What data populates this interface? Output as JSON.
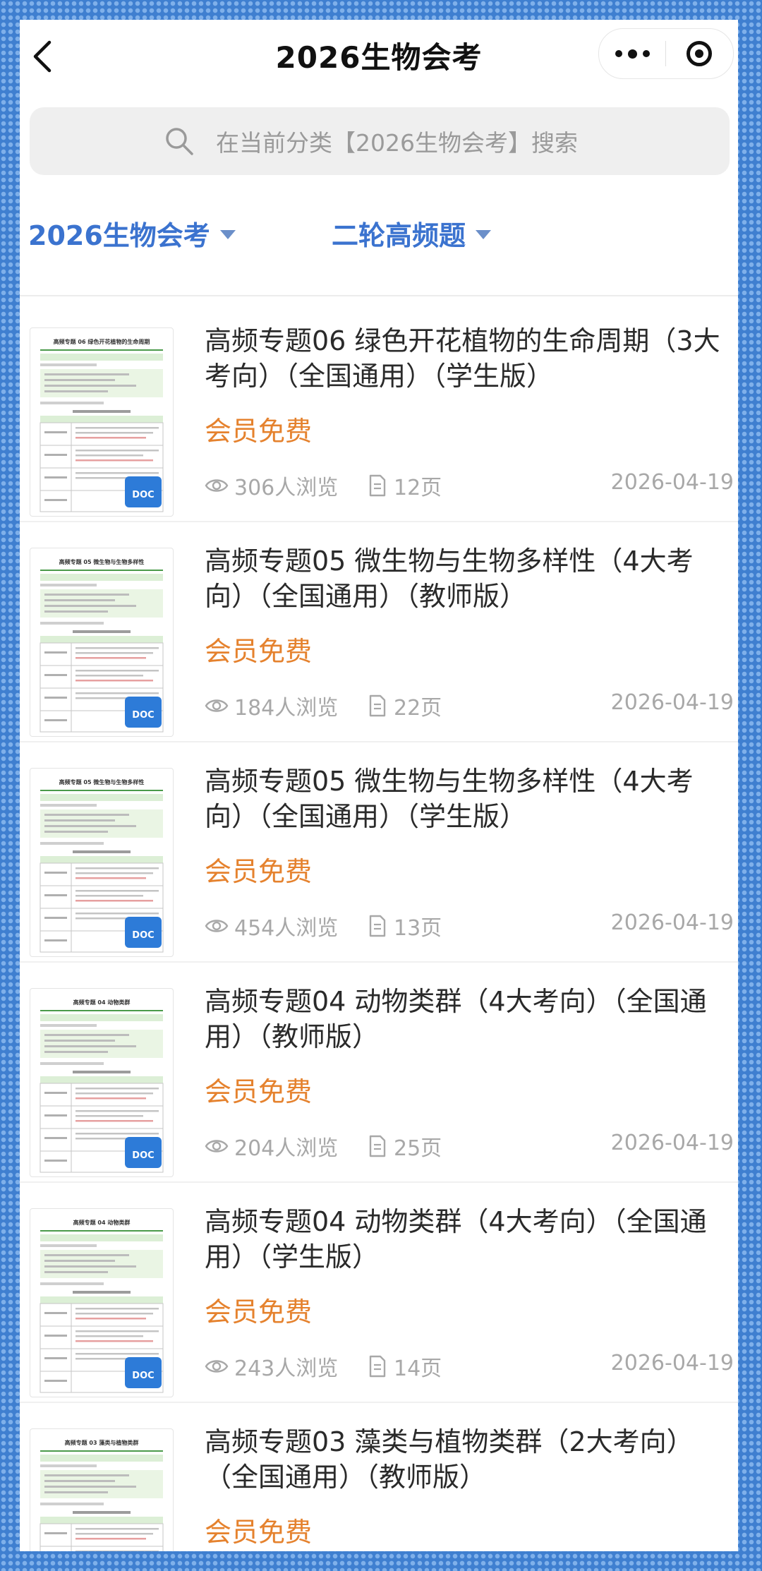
{
  "header": {
    "title": "2026生物会考"
  },
  "search": {
    "placeholder": "在当前分类【2026生物会考】搜索"
  },
  "filters": {
    "category": "2026生物会考",
    "type": "二轮高频题"
  },
  "colors": {
    "accent": "#3b73cf",
    "price": "#e5822e",
    "frame": "#3f7fd0"
  },
  "items": [
    {
      "title": "高频专题06 绿色开花植物的生命周期（3大考向）（全国通用）（学生版）",
      "price": "会员免费",
      "views": "306人浏览",
      "pages": "12页",
      "date": "2026-04-19",
      "thumb_title": "高频专题 06 绿色开花植物的生命周期",
      "badge": "DOC"
    },
    {
      "title": "高频专题05 微生物与生物多样性（4大考向）（全国通用）（教师版）",
      "price": "会员免费",
      "views": "184人浏览",
      "pages": "22页",
      "date": "2026-04-19",
      "thumb_title": "高频专题 05 微生物与生物多样性",
      "badge": "DOC"
    },
    {
      "title": "高频专题05 微生物与生物多样性（4大考向）（全国通用）（学生版）",
      "price": "会员免费",
      "views": "454人浏览",
      "pages": "13页",
      "date": "2026-04-19",
      "thumb_title": "高频专题 05 微生物与生物多样性",
      "badge": "DOC"
    },
    {
      "title": "高频专题04 动物类群（4大考向）（全国通用）（教师版）",
      "price": "会员免费",
      "views": "204人浏览",
      "pages": "25页",
      "date": "2026-04-19",
      "thumb_title": "高频专题 04 动物类群",
      "badge": "DOC"
    },
    {
      "title": "高频专题04 动物类群（4大考向）（全国通用）（学生版）",
      "price": "会员免费",
      "views": "243人浏览",
      "pages": "14页",
      "date": "2026-04-19",
      "thumb_title": "高频专题 04 动物类群",
      "badge": "DOC"
    },
    {
      "title": "高频专题03 藻类与植物类群（2大考向）（全国通用）（教师版）",
      "price": "会员免费",
      "views": "",
      "pages": "",
      "date": "",
      "thumb_title": "高频专题 03 藻类与植物类群",
      "badge": ""
    }
  ]
}
